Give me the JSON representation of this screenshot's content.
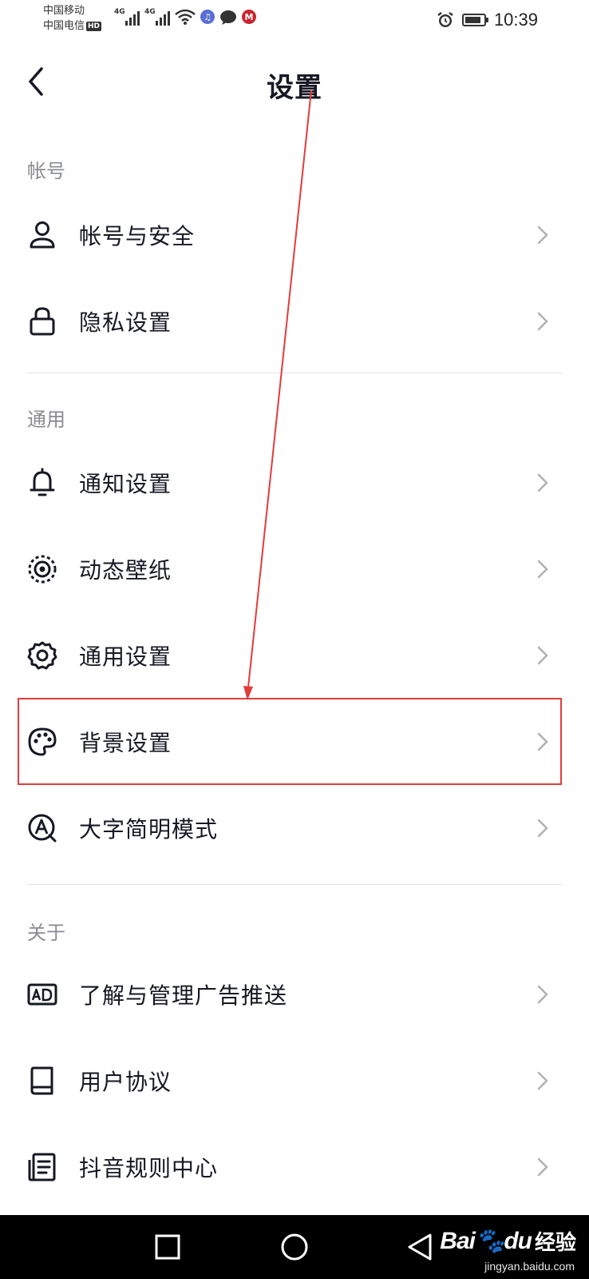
{
  "status_bar": {
    "carrier1": "中国移动",
    "carrier2": "中国电信",
    "hd_badge": "HD",
    "network1": "4G",
    "network2": "4G",
    "time": "10:39",
    "icons": [
      "signal-icon",
      "wifi-icon",
      "music-app-icon",
      "chat-app-icon",
      "bank-app-icon",
      "alarm-icon",
      "battery-icon"
    ],
    "battery_level": 0.85
  },
  "header": {
    "title": "设置",
    "back_icon": "chevron-left-icon"
  },
  "sections": [
    {
      "header": "帐号",
      "items": [
        {
          "label": "帐号与安全",
          "icon": "user-icon"
        },
        {
          "label": "隐私设置",
          "icon": "lock-icon"
        }
      ]
    },
    {
      "header": "通用",
      "items": [
        {
          "label": "通知设置",
          "icon": "bell-icon"
        },
        {
          "label": "动态壁纸",
          "icon": "live-wallpaper-icon"
        },
        {
          "label": "通用设置",
          "icon": "gear-icon"
        },
        {
          "label": "背景设置",
          "icon": "palette-icon",
          "highlighted": true
        },
        {
          "label": "大字简明模式",
          "icon": "large-font-icon"
        }
      ]
    },
    {
      "header": "关于",
      "items": [
        {
          "label": "了解与管理广告推送",
          "icon": "ad-icon"
        },
        {
          "label": "用户协议",
          "icon": "book-icon"
        },
        {
          "label": "抖音规则中心",
          "icon": "document-icon"
        }
      ]
    }
  ],
  "annotation": {
    "color": "#e33b3b",
    "target": "背景设置"
  },
  "bottom_nav": {
    "buttons": [
      "recent-apps-icon",
      "home-icon",
      "back-triangle-icon"
    ]
  },
  "watermark": {
    "brand": "Bai",
    "brand_suffix": "du",
    "jingyan": "经验",
    "url": "jingyan.baidu.com"
  },
  "colors": {
    "text_primary": "#161823",
    "text_secondary": "#8a8b91",
    "divider": "#e3e3e4",
    "chevron": "#b0b1b5"
  }
}
